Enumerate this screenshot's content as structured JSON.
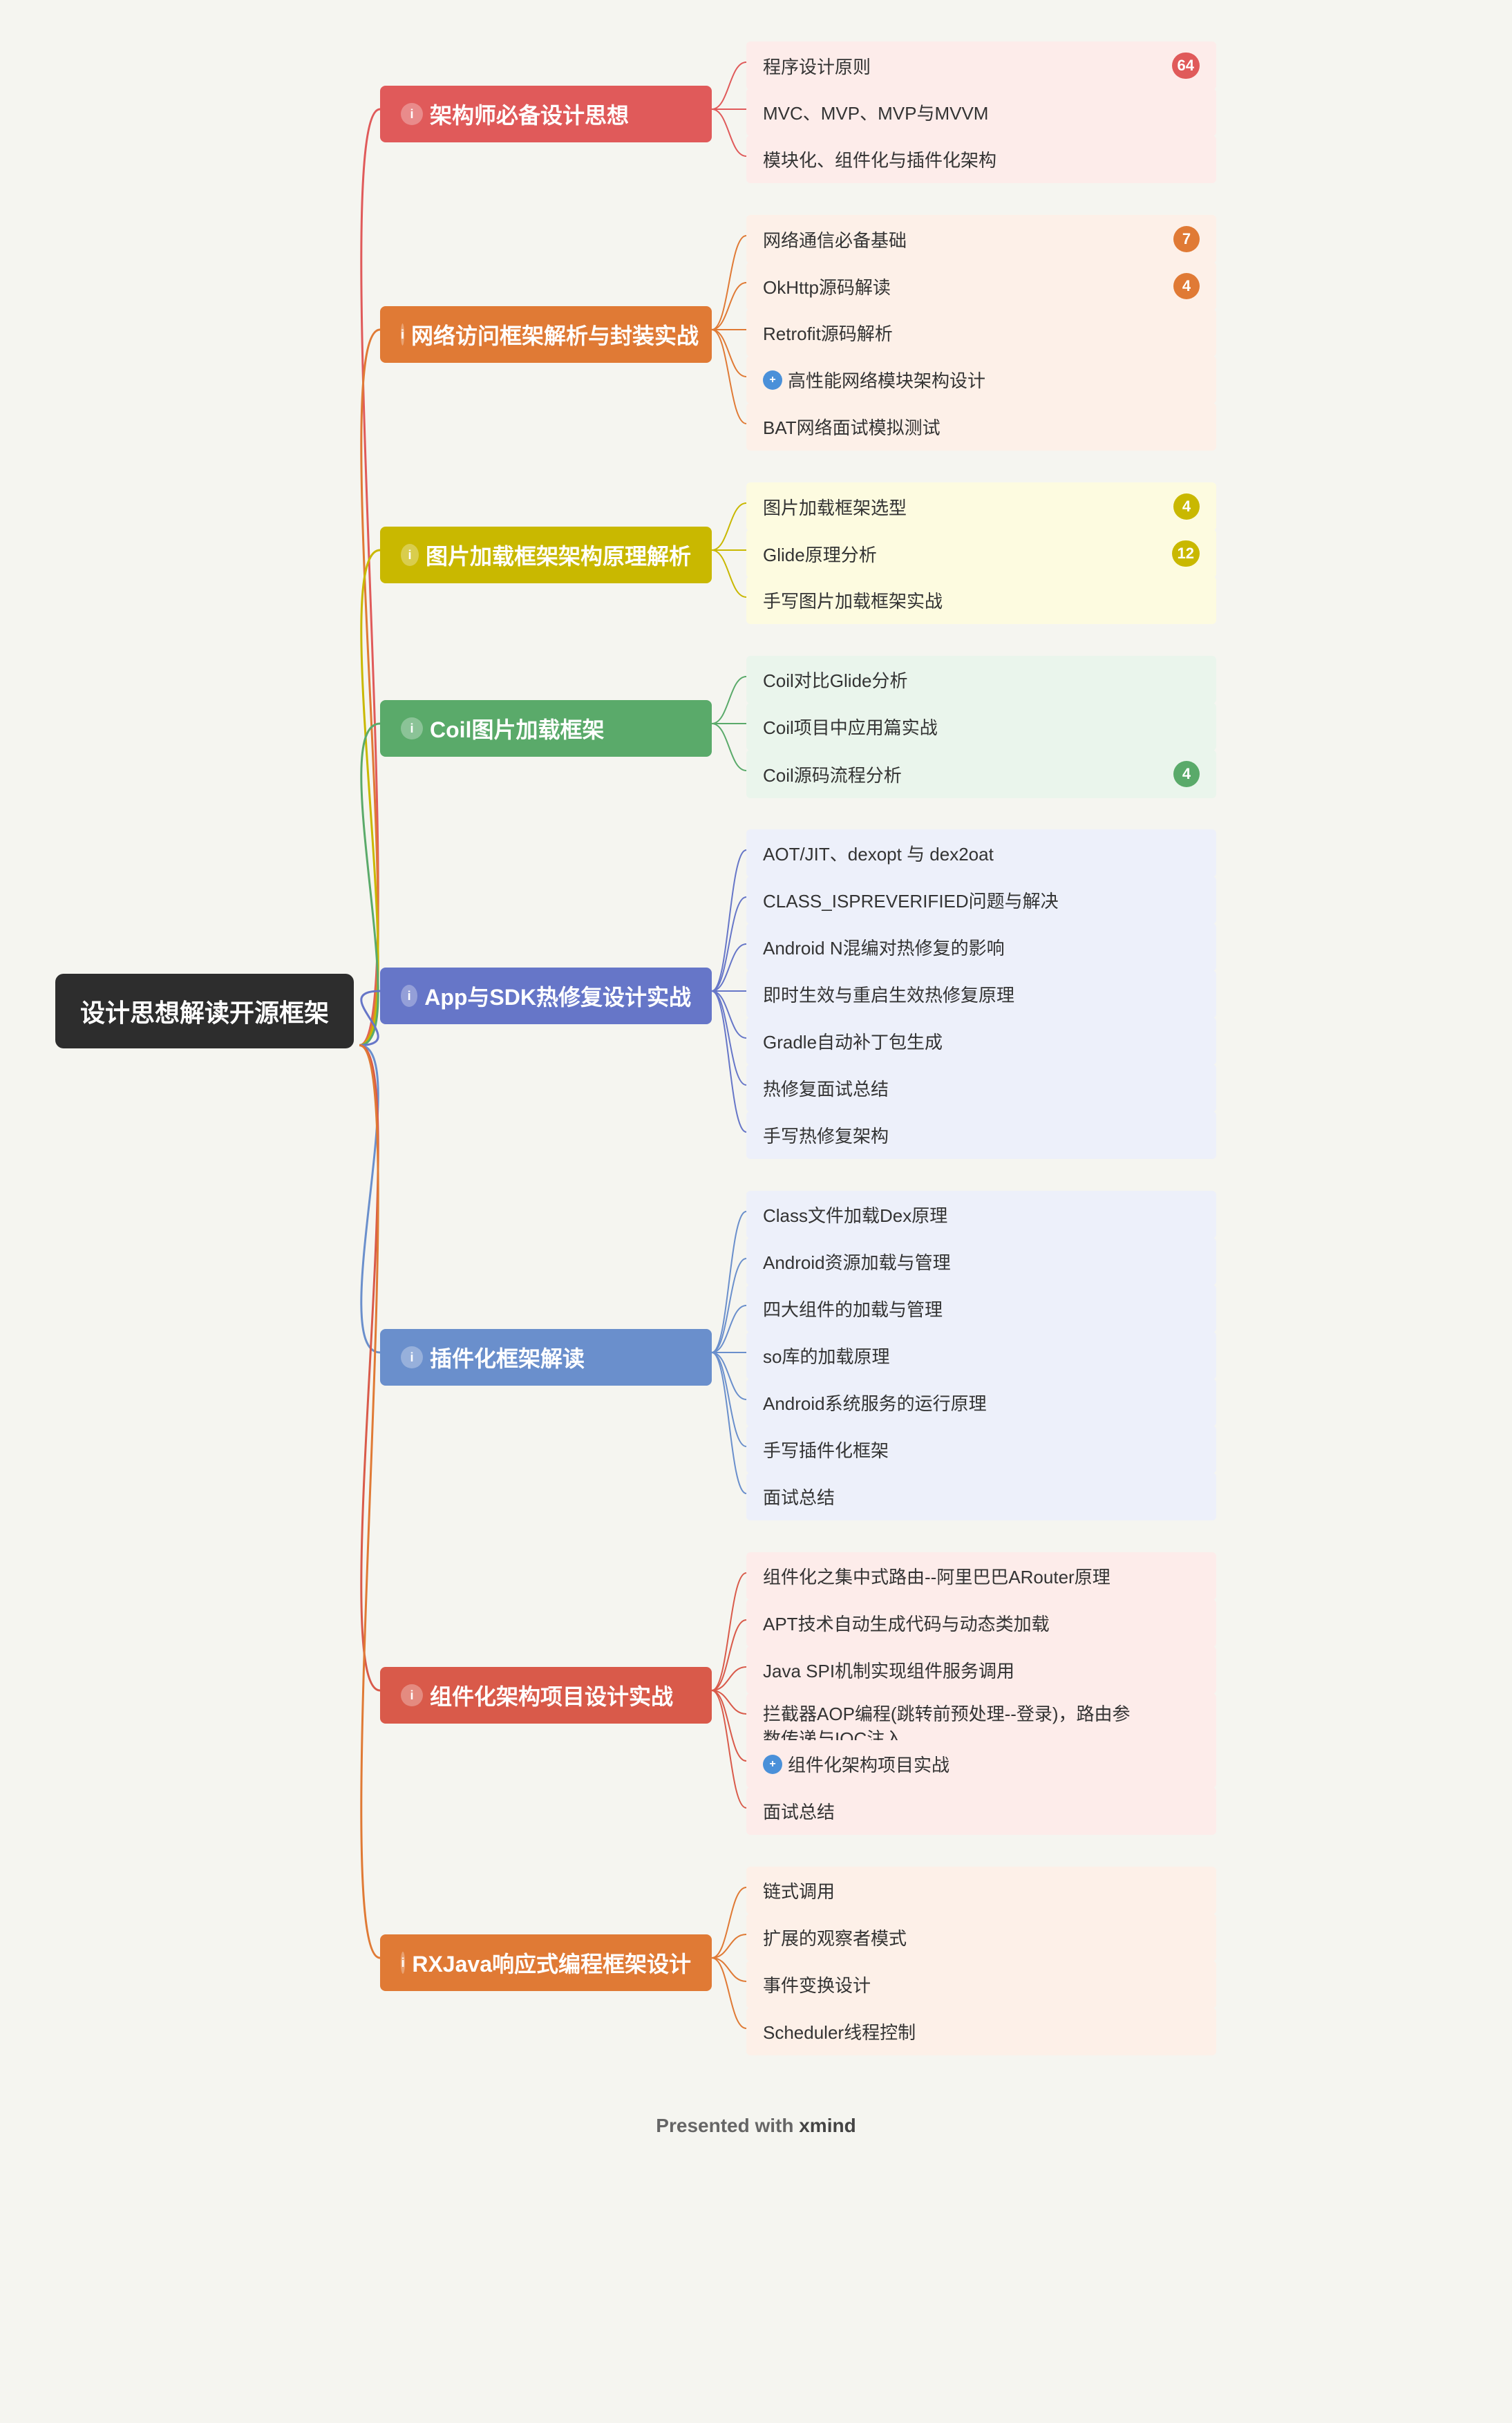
{
  "central": {
    "label": "设计思想解读开源框架"
  },
  "footer": {
    "prefix": "Presented with ",
    "brand": "xmind"
  },
  "branches": [
    {
      "id": "jiagou",
      "theme": "red",
      "topic": "架构师必备设计思想",
      "topY": 155,
      "topicLeft": 650,
      "leavesLeft": 1100,
      "icon": "i",
      "leaves": [
        {
          "text": "程序设计原则",
          "badge": "64",
          "hasBadge": true
        },
        {
          "text": "MVC、MVP、MVP与MVVM",
          "hasBadge": false
        },
        {
          "text": "模块化、组件化与插件化架构",
          "hasBadge": false
        }
      ]
    },
    {
      "id": "wangluo",
      "theme": "orange",
      "topic": "网络访问框架解析与封装实战",
      "topY": 430,
      "topicLeft": 610,
      "leavesLeft": 1100,
      "icon": "i",
      "leaves": [
        {
          "text": "网络通信必备基础",
          "badge": "7",
          "hasBadge": true
        },
        {
          "text": "OkHttp源码解读",
          "badge": "4",
          "hasBadge": true
        },
        {
          "text": "Retrofit源码解析",
          "hasBadge": false
        },
        {
          "text": "高性能网络模块架构设计",
          "hasBadge": false,
          "hasSpecialIcon": true
        },
        {
          "text": "BAT网络面试模拟测试",
          "hasBadge": false
        }
      ]
    },
    {
      "id": "tupian",
      "theme": "yellow",
      "topic": "图片加载框架架构原理解析",
      "topY": 790,
      "topicLeft": 620,
      "leavesLeft": 1100,
      "icon": "i",
      "leaves": [
        {
          "text": "图片加载框架选型",
          "badge": "4",
          "hasBadge": true
        },
        {
          "text": "Glide原理分析",
          "badge": "12",
          "hasBadge": true
        },
        {
          "text": "手写图片加载框架实战",
          "hasBadge": false
        }
      ]
    },
    {
      "id": "coil",
      "theme": "green",
      "topic": "Coil图片加载框架",
      "topY": 1060,
      "topicLeft": 680,
      "leavesLeft": 1100,
      "icon": "i",
      "leaves": [
        {
          "text": "Coil对比Glide分析",
          "hasBadge": false
        },
        {
          "text": "Coil项目中应用篇实战",
          "hasBadge": false
        },
        {
          "text": "Coil源码流程分析",
          "badge": "4",
          "hasBadge": true
        }
      ]
    },
    {
      "id": "hotfix",
      "theme": "blue",
      "topic": "App与SDK热修复设计实战",
      "topY": 1290,
      "topicLeft": 620,
      "leavesLeft": 1100,
      "icon": "i",
      "leaves": [
        {
          "text": "AOT/JIT、dexopt 与 dex2oat",
          "hasBadge": false
        },
        {
          "text": "CLASS_ISPREVERIFIED问题与解决",
          "hasBadge": false
        },
        {
          "text": "Android N混编对热修复的影响",
          "hasBadge": false
        },
        {
          "text": "即时生效与重启生效热修复原理",
          "hasBadge": false
        },
        {
          "text": "Gradle自动补丁包生成",
          "hasBadge": false
        },
        {
          "text": "热修复面试总结",
          "hasBadge": false
        },
        {
          "text": "手写热修复架构",
          "hasBadge": false
        }
      ]
    },
    {
      "id": "plugin",
      "theme": "blue2",
      "topic": "插件化框架解读",
      "topY": 1830,
      "topicLeft": 700,
      "leavesLeft": 1100,
      "icon": "i",
      "leaves": [
        {
          "text": "Class文件加载Dex原理",
          "hasBadge": false
        },
        {
          "text": "Android资源加载与管理",
          "hasBadge": false
        },
        {
          "text": "四大组件的加载与管理",
          "hasBadge": false
        },
        {
          "text": "so库的加载原理",
          "hasBadge": false
        },
        {
          "text": "Android系统服务的运行原理",
          "hasBadge": false
        },
        {
          "text": "手写插件化框架",
          "hasBadge": false
        },
        {
          "text": "面试总结",
          "hasBadge": false
        }
      ]
    },
    {
      "id": "component",
      "theme": "red2",
      "topic": "组件化架构项目设计实战",
      "topY": 2360,
      "topicLeft": 620,
      "leavesLeft": 1100,
      "icon": "i",
      "leaves": [
        {
          "text": "组件化之集中式路由--阿里巴巴ARouter原理",
          "hasBadge": false
        },
        {
          "text": "APT技术自动生成代码与动态类加载",
          "hasBadge": false
        },
        {
          "text": "Java SPI机制实现组件服务调用",
          "hasBadge": false
        },
        {
          "text": "拦截器AOP编程(跳转前预处理--登录)，路由参\n数传递与IOC注入",
          "hasBadge": false,
          "multiline": true
        },
        {
          "text": "组件化架构项目实战",
          "hasBadge": false,
          "hasSpecialIcon": true
        },
        {
          "text": "面试总结",
          "hasBadge": false
        }
      ]
    },
    {
      "id": "rxjava",
      "theme": "orange2",
      "topic": "RXJava响应式编程框架设计",
      "topY": 2980,
      "topicLeft": 615,
      "leavesLeft": 1100,
      "icon": "i",
      "leaves": [
        {
          "text": "链式调用",
          "hasBadge": false
        },
        {
          "text": "扩展的观察者模式",
          "hasBadge": false
        },
        {
          "text": "事件变换设计",
          "hasBadge": false
        },
        {
          "text": "Scheduler线程控制",
          "hasBadge": false
        }
      ]
    }
  ]
}
